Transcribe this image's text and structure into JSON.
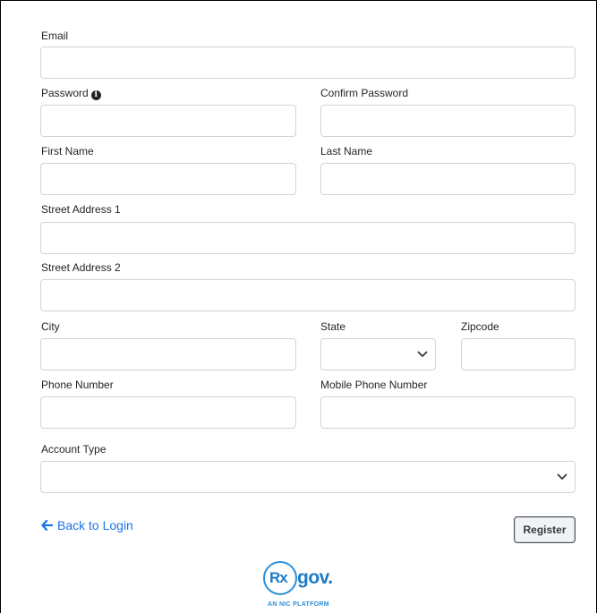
{
  "form": {
    "email_label": "Email",
    "email_value": "",
    "password_label": "Password",
    "password_value": "",
    "confirm_password_label": "Confirm Password",
    "confirm_password_value": "",
    "first_name_label": "First Name",
    "first_name_value": "",
    "last_name_label": "Last Name",
    "last_name_value": "",
    "street1_label": "Street Address 1",
    "street1_value": "",
    "street2_label": "Street Address 2",
    "street2_value": "",
    "city_label": "City",
    "city_value": "",
    "state_label": "State",
    "state_selected": "",
    "zipcode_label": "Zipcode",
    "zipcode_value": "",
    "phone_label": "Phone Number",
    "phone_value": "",
    "mobile_label": "Mobile Phone Number",
    "mobile_value": "",
    "account_type_label": "Account Type",
    "account_type_selected": ""
  },
  "actions": {
    "back_label": "Back to Login",
    "register_label": "Register"
  },
  "logo": {
    "rx": "Rx",
    "gov": "gov.",
    "tagline": "AN NIC PLATFORM"
  },
  "icons": {
    "password_info": "info-circle-icon",
    "back": "arrow-left-icon",
    "dropdown": "chevron-down-icon"
  },
  "colors": {
    "link": "#1a73e8",
    "brand": "#1f7ac4",
    "input_border": "#ced4da"
  }
}
